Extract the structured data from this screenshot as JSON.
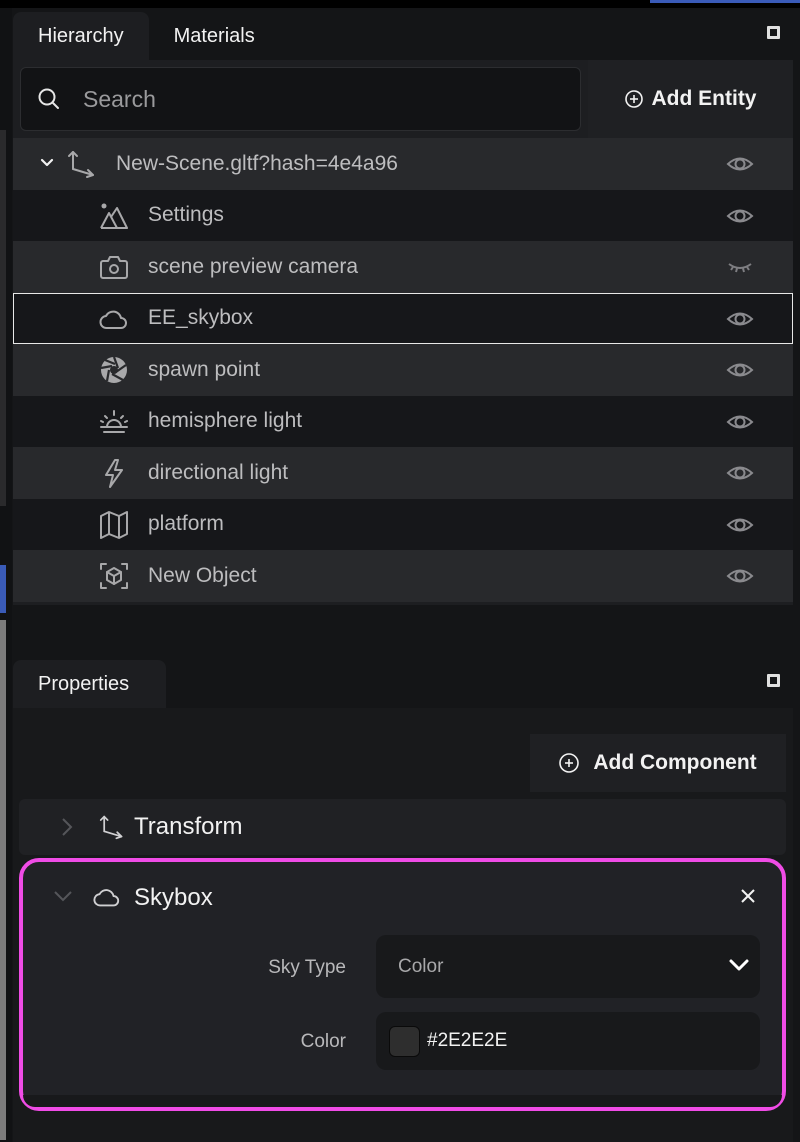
{
  "hierarchy_panel": {
    "tabs": [
      {
        "label": "Hierarchy",
        "active": true
      },
      {
        "label": "Materials",
        "active": false
      }
    ],
    "search": {
      "placeholder": "Search",
      "value": ""
    },
    "add_entity_label": "Add Entity",
    "tree": [
      {
        "label": "New-Scene.gltf?hash=4e4a96",
        "icon": "axes-icon",
        "root": true,
        "expanded": true,
        "visible": true
      },
      {
        "label": "Settings",
        "icon": "mountain-icon",
        "visible": true
      },
      {
        "label": "scene preview camera",
        "icon": "camera-icon",
        "visible": false
      },
      {
        "label": "EE_skybox",
        "icon": "cloud-icon",
        "visible": true,
        "selected": true
      },
      {
        "label": "spawn point",
        "icon": "aperture-icon",
        "visible": true
      },
      {
        "label": "hemisphere light",
        "icon": "sunrise-icon",
        "visible": true
      },
      {
        "label": "directional light",
        "icon": "lightning-icon",
        "visible": true
      },
      {
        "label": "platform",
        "icon": "map-icon",
        "visible": true
      },
      {
        "label": "New Object",
        "icon": "cube-icon",
        "visible": true
      }
    ]
  },
  "properties_panel": {
    "tab_label": "Properties",
    "add_component_label": "Add Component",
    "components": [
      {
        "title": "Transform",
        "icon": "axes-icon",
        "expanded": false
      },
      {
        "title": "Skybox",
        "icon": "cloud-icon",
        "expanded": true,
        "highlighted": true,
        "fields": {
          "sky_type": {
            "label": "Sky Type",
            "value": "Color"
          },
          "color": {
            "label": "Color",
            "value": "#2E2E2E",
            "swatch": "#2e2e2e"
          }
        }
      }
    ]
  },
  "colors": {
    "highlight": "#f04ce6",
    "accent": "#3a5bb8"
  }
}
